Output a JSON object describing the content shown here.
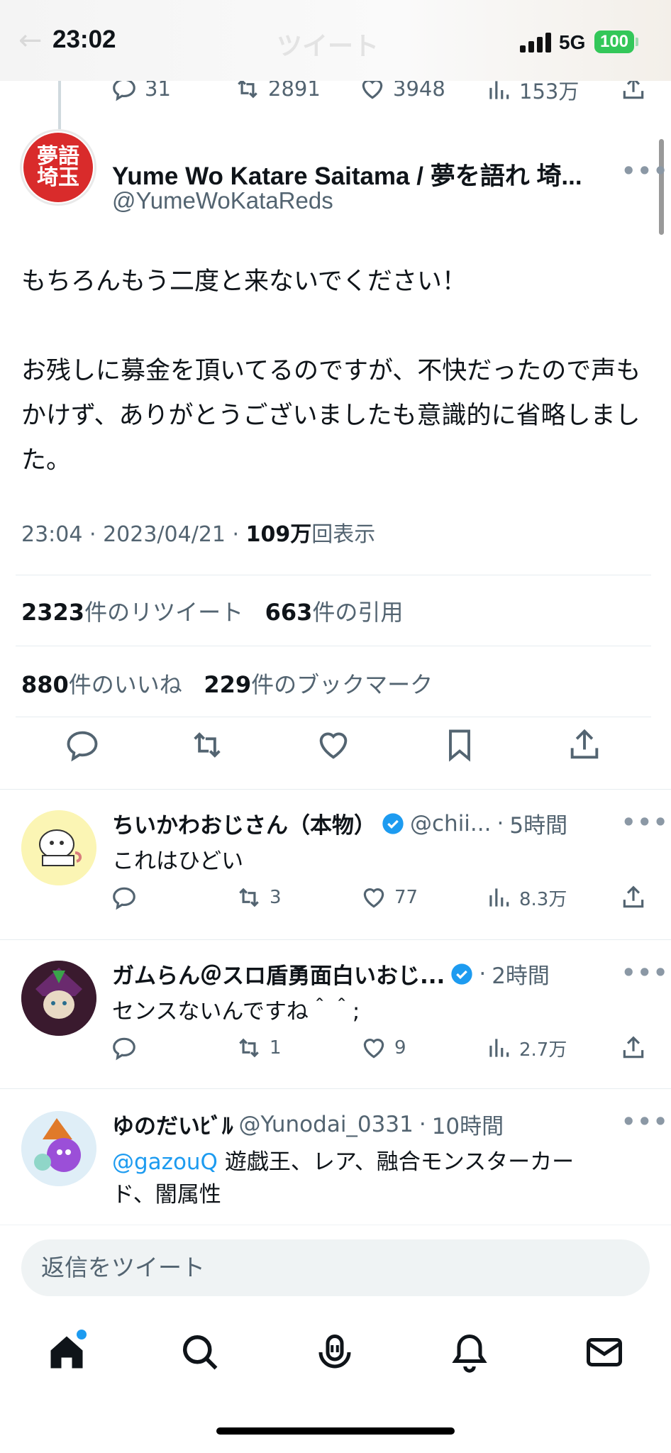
{
  "status": {
    "time": "23:02",
    "network": "5G",
    "battery": "100",
    "ghost_title": "ツイート"
  },
  "previous_tweet_actions": {
    "replies": "31",
    "retweets": "2891",
    "likes": "3948",
    "views": "153万"
  },
  "main_tweet": {
    "author_name": "Yume Wo Katare Saitama / 夢を語れ 埼...",
    "author_handle": "@YumeWoKataReds",
    "avatar_text": "夢を語れ埼玉",
    "text": "もちろんもう二度と来ないでください！\n\nお残しに募金を頂いてるのですが、不快だったので声もかけず、ありがとうございましたも意識的に省略しました。",
    "time": "23:04",
    "date": "2023/04/21",
    "views": "109万",
    "views_label": "回表示",
    "retweets": "2323",
    "retweets_label": "件のリツイート",
    "quotes": "663",
    "quotes_label": "件の引用",
    "likes": "880",
    "likes_label": "件のいいね",
    "bookmarks": "229",
    "bookmarks_label": "件のブックマーク"
  },
  "replies": [
    {
      "name": "ちいかわおじさん（本物）",
      "verified": true,
      "handle": "@chii...",
      "time": "5時間",
      "text": "これはひどい",
      "mention": "",
      "retweets": "3",
      "likes": "77",
      "views": "8.3万"
    },
    {
      "name": "ガムらん＠スロ盾勇面白いおじ...",
      "verified": true,
      "handle": "",
      "time": "2時間",
      "text": "センスないんですね＾＾;",
      "mention": "",
      "retweets": "1",
      "likes": "9",
      "views": "2.7万"
    },
    {
      "name": "ゆのだいﾋﾞﾙ",
      "verified": false,
      "handle": "@Yunodai_0331",
      "time": "10時間",
      "mention": "@gazouQ",
      "text": "遊戯王、レア、融合モンスターカー",
      "text2": "ド、闇属性"
    }
  ],
  "compose": {
    "placeholder": "返信をツイート"
  },
  "colors": {
    "accent": "#1d9bf0",
    "text": "#0f1419",
    "muted": "#536471",
    "battery": "#33c759"
  },
  "tabs": [
    "home-icon",
    "search-icon",
    "spaces-icon",
    "notifications-icon",
    "messages-icon"
  ]
}
